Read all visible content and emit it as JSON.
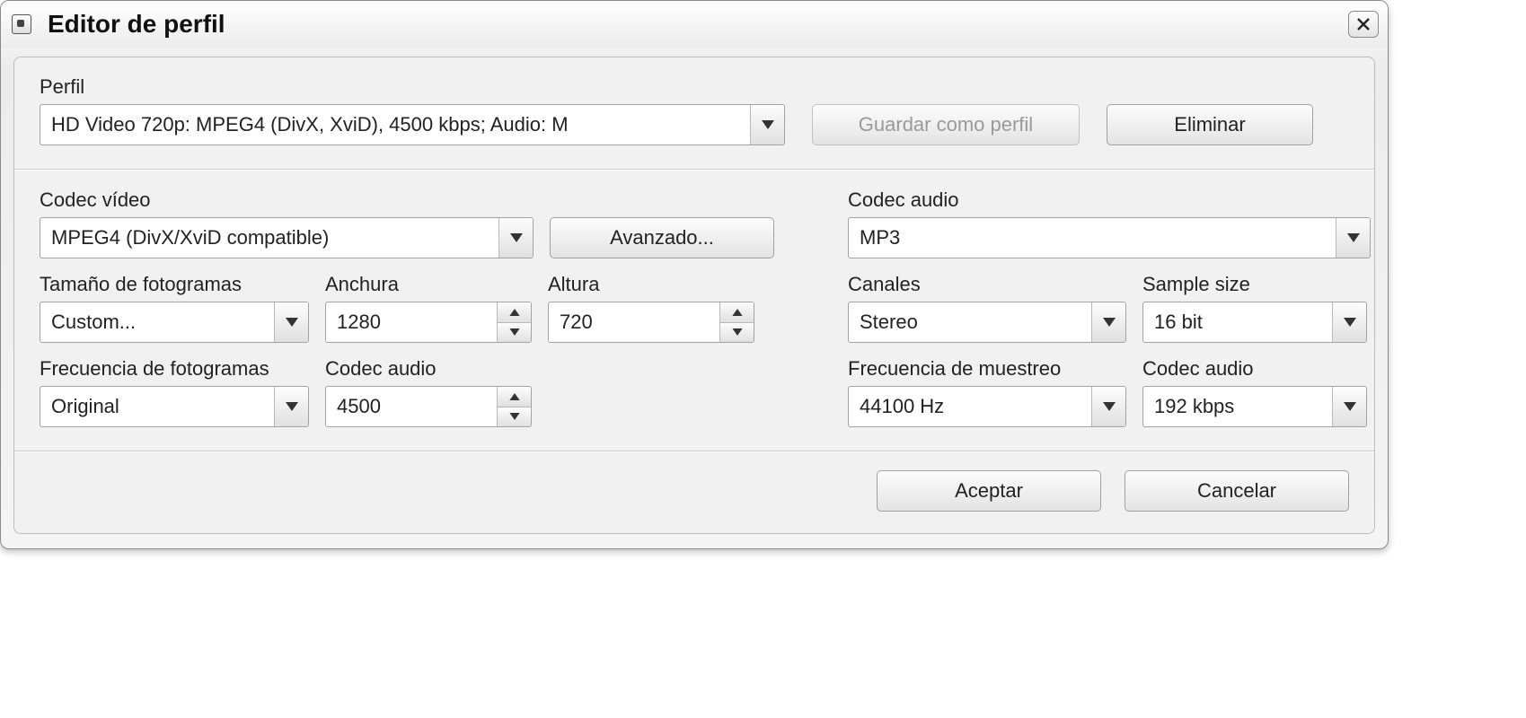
{
  "title": "Editor de perfil",
  "profile": {
    "label": "Perfil",
    "value": "HD Video 720p: MPEG4 (DivX, XviD), 4500 kbps; Audio: M",
    "save_btn": "Guardar como perfil",
    "delete_btn": "Eliminar"
  },
  "video": {
    "codec_label": "Codec vídeo",
    "codec_value": "MPEG4 (DivX/XviD compatible)",
    "advanced_btn": "Avanzado...",
    "frame_size_label": "Tamaño de fotogramas",
    "frame_size_value": "Custom...",
    "width_label": "Anchura",
    "width_value": "1280",
    "height_label": "Altura",
    "height_value": "720",
    "frame_rate_label": "Frecuencia de fotogramas",
    "frame_rate_value": "Original",
    "bitrate_label": "Codec audio",
    "bitrate_value": "4500"
  },
  "audio": {
    "codec_label": "Codec audio",
    "codec_value": "MP3",
    "channels_label": "Canales",
    "channels_value": "Stereo",
    "sample_size_label": "Sample size",
    "sample_size_value": "16 bit",
    "sample_rate_label": "Frecuencia de muestreo",
    "sample_rate_value": "44100 Hz",
    "bitrate_label": "Codec audio",
    "bitrate_value": "192 kbps"
  },
  "actions": {
    "ok": "Aceptar",
    "cancel": "Cancelar"
  }
}
